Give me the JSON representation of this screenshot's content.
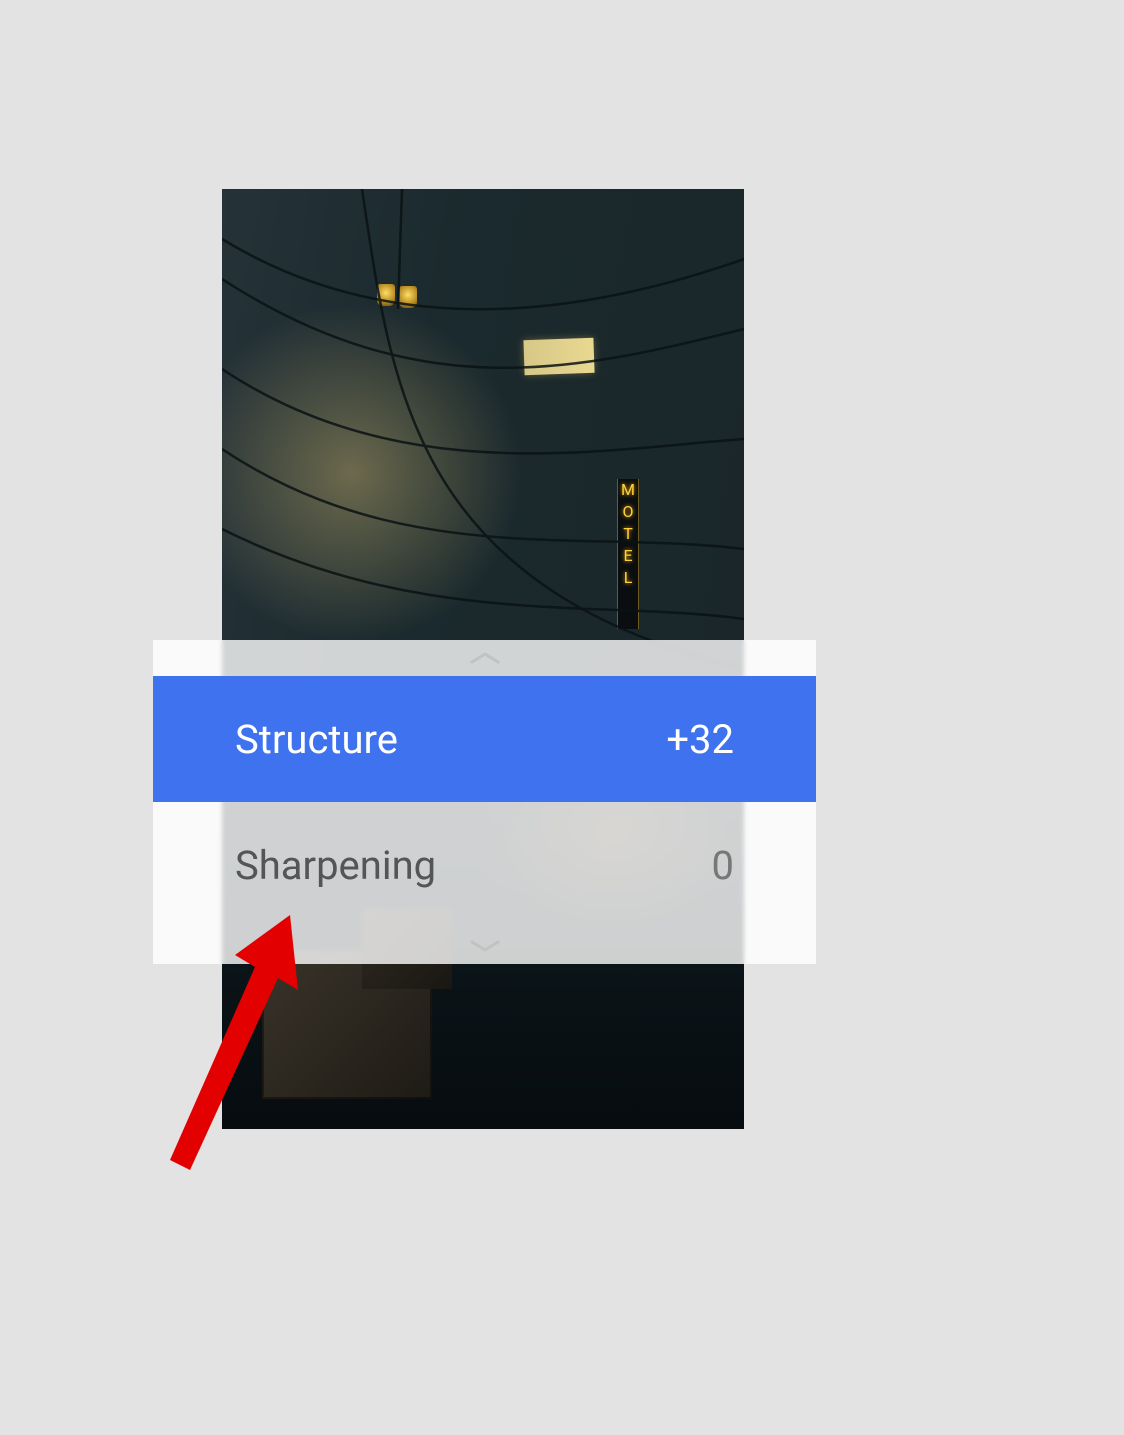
{
  "panel": {
    "options": [
      {
        "label": "Structure",
        "value": "+32",
        "selected": true
      },
      {
        "label": "Sharpening",
        "value": "0",
        "selected": false
      }
    ]
  },
  "scene": {
    "sign_text": "MOTEL"
  },
  "colors": {
    "accent": "#3e72ee",
    "annotation": "#e30000"
  }
}
